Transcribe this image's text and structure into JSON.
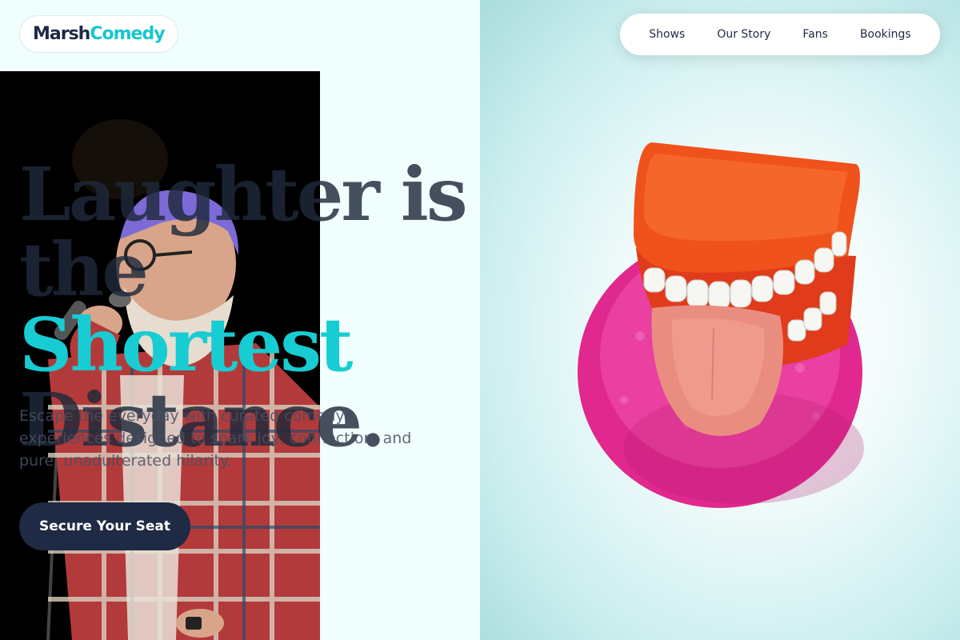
{
  "brand": {
    "part1": "Marsh",
    "part2": "Comedy",
    "accent_color": "#16c6cf"
  },
  "nav": {
    "items": [
      "Shows",
      "Our Story",
      "Fans",
      "Bookings"
    ]
  },
  "hero": {
    "line1": "Laughter is",
    "line2_plain": "the ",
    "line2_accent": "Shortest",
    "line3": "Distance.",
    "subtitle": "Escape the everyday with curated comedy experiences designed to spark joy, connection, and pure, unadulterated hilarity.",
    "cta": "Secure Your Seat"
  },
  "images": {
    "left": "comedian-with-microphone-photo",
    "right": "wind-up-chattering-teeth-toy-photo"
  },
  "colors": {
    "dark": "#1f2a44",
    "accent": "#17ccd2",
    "background": "#f0fefd"
  }
}
